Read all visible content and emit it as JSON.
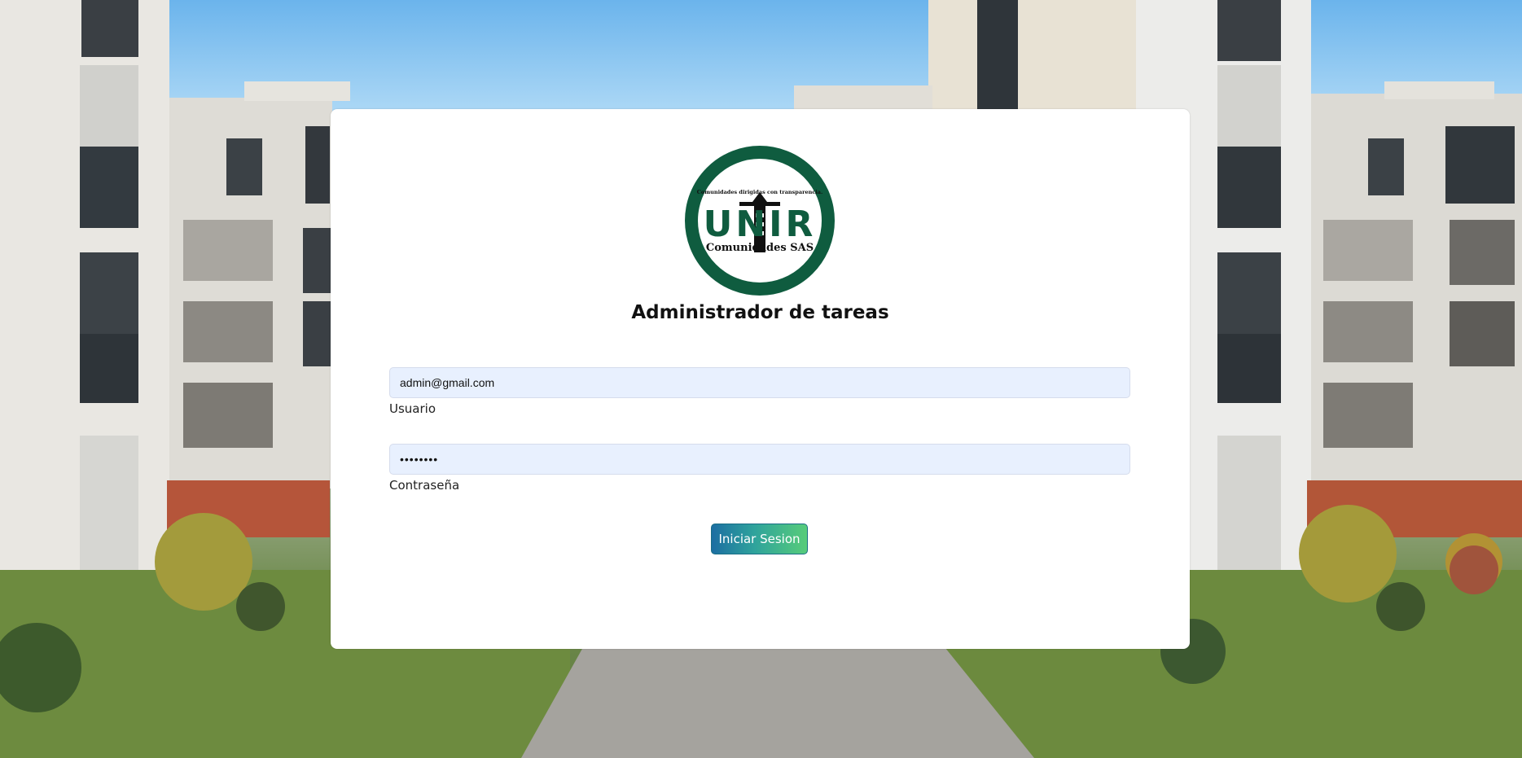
{
  "app": {
    "title": "Administrador de tareas"
  },
  "logo": {
    "top_text": "Comunidades dirigidas con transparencia.",
    "brand_text": "UNIR",
    "bottom_text": "Comunidades SAS",
    "ring_color": "#0f5c3f"
  },
  "form": {
    "username": {
      "value": "admin@gmail.com",
      "label": "Usuario"
    },
    "password": {
      "masked_value": "••••••••",
      "label": "Contraseña"
    },
    "submit_label": "Iniciar Sesion"
  },
  "colors": {
    "card_bg": "#ffffff",
    "input_bg": "#e8f0fe",
    "button_gradient_start": "#1c6ea2",
    "button_gradient_end": "#57cc7a"
  }
}
